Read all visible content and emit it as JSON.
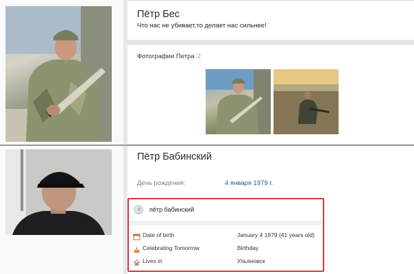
{
  "profile_top": {
    "name": "Пётр Бес",
    "status": "Что нас не убивает,то делает нас сильнее!",
    "photos_title": "Фотографии Петра",
    "photos_count": "2"
  },
  "profile_bottom": {
    "name": "Пётр Бабинский",
    "birthday_label": "День рождения:",
    "birthday_value": "4 января 1979 г."
  },
  "info_card": {
    "name": "пётр бабинский",
    "rows": [
      {
        "icon": "calendar-icon",
        "label": "Date of birth",
        "value": "January 4 1979 (41 years old)"
      },
      {
        "icon": "cake-icon",
        "label": "Celebrating Tomorrow",
        "value": "Birthday"
      },
      {
        "icon": "home-icon",
        "label": "Lives in",
        "value": "Ульяновск"
      }
    ],
    "border_color": "#d43a3a"
  },
  "colors": {
    "link": "#2a5885",
    "muted": "#828282",
    "count": "#8a99ab"
  }
}
